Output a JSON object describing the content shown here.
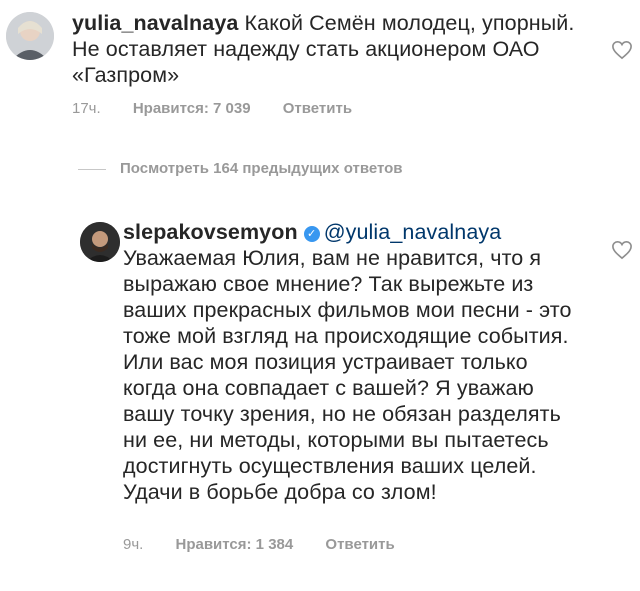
{
  "comment1": {
    "username": "yulia_navalnaya",
    "body": "Какой Семён молодец, упорный. Не оставляет надежду стать акционером  ОАО «Газпром»",
    "time": "17ч.",
    "likes": "Нравится: 7 039",
    "reply": "Ответить"
  },
  "view_replies": "Посмотреть 164 предыдущих ответов",
  "comment2": {
    "username": "slepakovsemyon",
    "mention": "@yulia_navalnaya",
    "body": "Уважаемая Юлия, вам не нравится, что я выражаю свое мнение? Так вырежьте из ваших прекрасных фильмов мои песни - это тоже мой взгляд на происходящие события. Или вас моя позиция устраивает только когда она совпадает с вашей? Я уважаю вашу точку зрения, но не обязан разделять ни ее, ни методы, которыми вы пытаетесь достигнуть осуществления ваших целей. Удачи в борьбе добра со злом!",
    "time": "9ч.",
    "likes": "Нравится: 1 384",
    "reply": "Ответить"
  },
  "icons": {
    "heart": "heart-outline-icon",
    "verified": "verified-badge-icon"
  },
  "colors": {
    "text": "#262626",
    "meta": "#999999",
    "mention": "#00376b",
    "verified": "#3897f0"
  }
}
